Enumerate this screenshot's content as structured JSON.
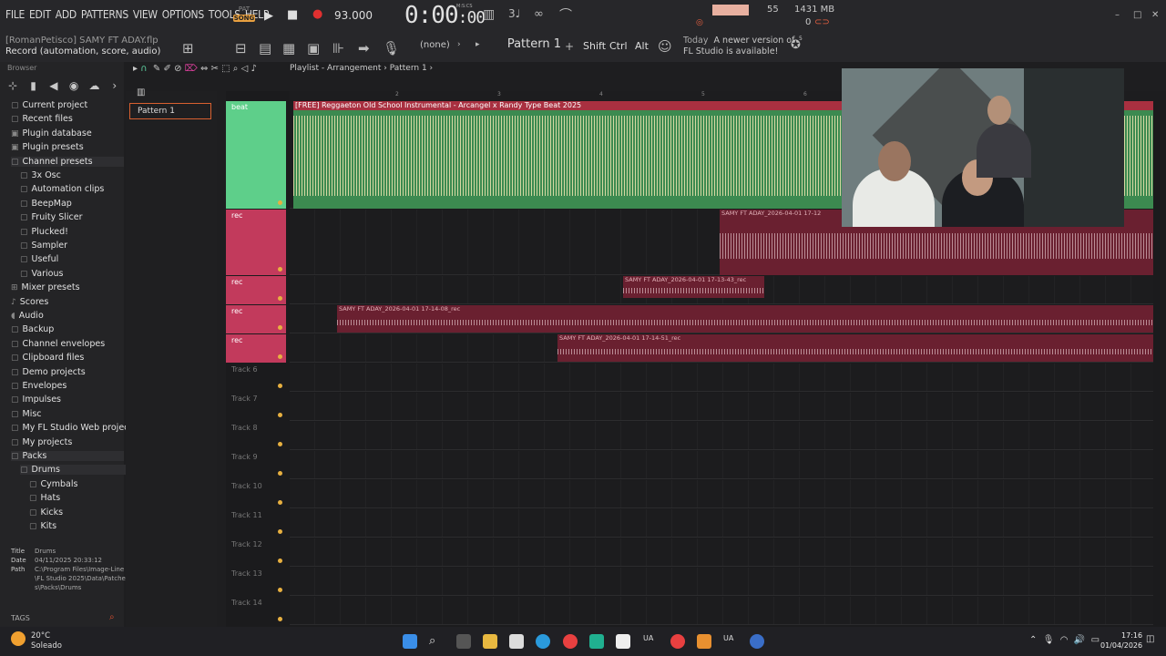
{
  "menu": [
    "FILE",
    "EDIT",
    "ADD",
    "PATTERNS",
    "VIEW",
    "OPTIONS",
    "TOOLS",
    "HELP"
  ],
  "transport": {
    "pat_label": "PAT",
    "song_label": "SONG",
    "tempo": "93.000",
    "time": "0:00",
    "time_sub": ":00",
    "time_units": "M:S:CS",
    "cpu_value": "55",
    "memory": "1431 MB",
    "memory_small": "0"
  },
  "project": {
    "title": "[RomanPetisco] SAMY FT ADAY.flp",
    "record_mode": "Record  (automation, score, audio)"
  },
  "toolbar2": {
    "none_label": "(none)",
    "pattern": "Pattern 1",
    "shift": "Shift",
    "ctrl": "Ctrl",
    "alt": "Alt",
    "news_when": "Today",
    "news_text_1": "A newer version of",
    "news_text_2": "FL Studio is available!",
    "badge": "5"
  },
  "browser": {
    "header": "Browser",
    "items": [
      {
        "label": "Current project",
        "icon": "folder-icon"
      },
      {
        "label": "Recent files",
        "icon": "folder-icon"
      },
      {
        "label": "Plugin database",
        "icon": "plugin-icon"
      },
      {
        "label": "Plugin presets",
        "icon": "plugin-icon"
      },
      {
        "label": "Channel presets",
        "icon": "folder-icon"
      },
      {
        "label": "3x Osc",
        "icon": "folder-icon"
      },
      {
        "label": "Automation clips",
        "icon": "folder-icon"
      },
      {
        "label": "BeepMap",
        "icon": "folder-icon"
      },
      {
        "label": "Fruity Slicer",
        "icon": "folder-icon"
      },
      {
        "label": "Plucked!",
        "icon": "folder-icon"
      },
      {
        "label": "Sampler",
        "icon": "folder-icon"
      },
      {
        "label": "Useful",
        "icon": "folder-icon"
      },
      {
        "label": "Various",
        "icon": "folder-icon"
      },
      {
        "label": "Mixer presets",
        "icon": "mixer-icon"
      },
      {
        "label": "Scores",
        "icon": "note-icon"
      },
      {
        "label": "Audio",
        "icon": "speaker-icon"
      },
      {
        "label": "Backup",
        "icon": "folder-icon"
      },
      {
        "label": "Channel envelopes",
        "icon": "folder-icon"
      },
      {
        "label": "Clipboard files",
        "icon": "folder-icon"
      },
      {
        "label": "Demo projects",
        "icon": "folder-icon"
      },
      {
        "label": "Envelopes",
        "icon": "folder-icon"
      },
      {
        "label": "Impulses",
        "icon": "folder-icon"
      },
      {
        "label": "Misc",
        "icon": "folder-icon"
      },
      {
        "label": "My FL Studio Web projects",
        "icon": "folder-icon"
      },
      {
        "label": "My projects",
        "icon": "folder-icon"
      },
      {
        "label": "Packs",
        "icon": "folder-icon"
      },
      {
        "label": "Drums",
        "icon": "folder-icon"
      },
      {
        "label": "Cymbals",
        "icon": "folder-icon"
      },
      {
        "label": "Hats",
        "icon": "folder-icon"
      },
      {
        "label": "Kicks",
        "icon": "folder-icon"
      },
      {
        "label": "Kits",
        "icon": "folder-icon"
      }
    ],
    "info": {
      "title_k": "Title",
      "title_v": "Drums",
      "date_k": "Date",
      "date_v": "04/11/2025 20:33:12",
      "path_k": "Path",
      "path_v": "C:\\Program Files\\Image-Line\\FL Studio 2025\\Data\\Patches\\Packs\\Drums"
    },
    "tags": "TAGS"
  },
  "patterns": {
    "list": [
      "Pattern 1"
    ]
  },
  "playlist": {
    "breadcrumb": "Playlist - Arrangement",
    "pattern": "Pattern 1",
    "bar_numbers": [
      "2",
      "3",
      "4",
      "5",
      "6"
    ],
    "tracks": [
      {
        "name": "beat",
        "color": "#5ecf8a"
      },
      {
        "name": "rec",
        "color": "#c23a5c"
      },
      {
        "name": "rec",
        "color": "#c23a5c"
      },
      {
        "name": "rec",
        "color": "#c23a5c"
      },
      {
        "name": "rec",
        "color": "#c23a5c"
      },
      {
        "name": "Track 6"
      },
      {
        "name": "Track 7"
      },
      {
        "name": "Track 8"
      },
      {
        "name": "Track 9"
      },
      {
        "name": "Track 10"
      },
      {
        "name": "Track 11"
      },
      {
        "name": "Track 12"
      },
      {
        "name": "Track 13"
      },
      {
        "name": "Track 14"
      }
    ],
    "clips": [
      {
        "label": "[FREE] Reggaeton Old School Instrumental - Arcangel x Randy Type Beat 2025",
        "track": 1
      },
      {
        "label": "SAMY FT ADAY_2026-04-01 17-12",
        "track": 2
      },
      {
        "label": "SAMY FT ADAY_2026-04-01 17-13-43_rec",
        "track": 3
      },
      {
        "label": "SAMY FT ADAY_2026-04-01 17-14-08_rec",
        "track": 4
      },
      {
        "label": "SAMY FT ADAY_2026-04-01 17-14-51_rec",
        "track": 5
      }
    ]
  },
  "taskbar": {
    "temp": "20°C",
    "weather": "Soleado",
    "time": "17:16",
    "date": "01/04/2026"
  },
  "colors": {
    "accent": "#e8a040",
    "beat_track": "#5ecf8a",
    "rec_track": "#c23a5c"
  }
}
